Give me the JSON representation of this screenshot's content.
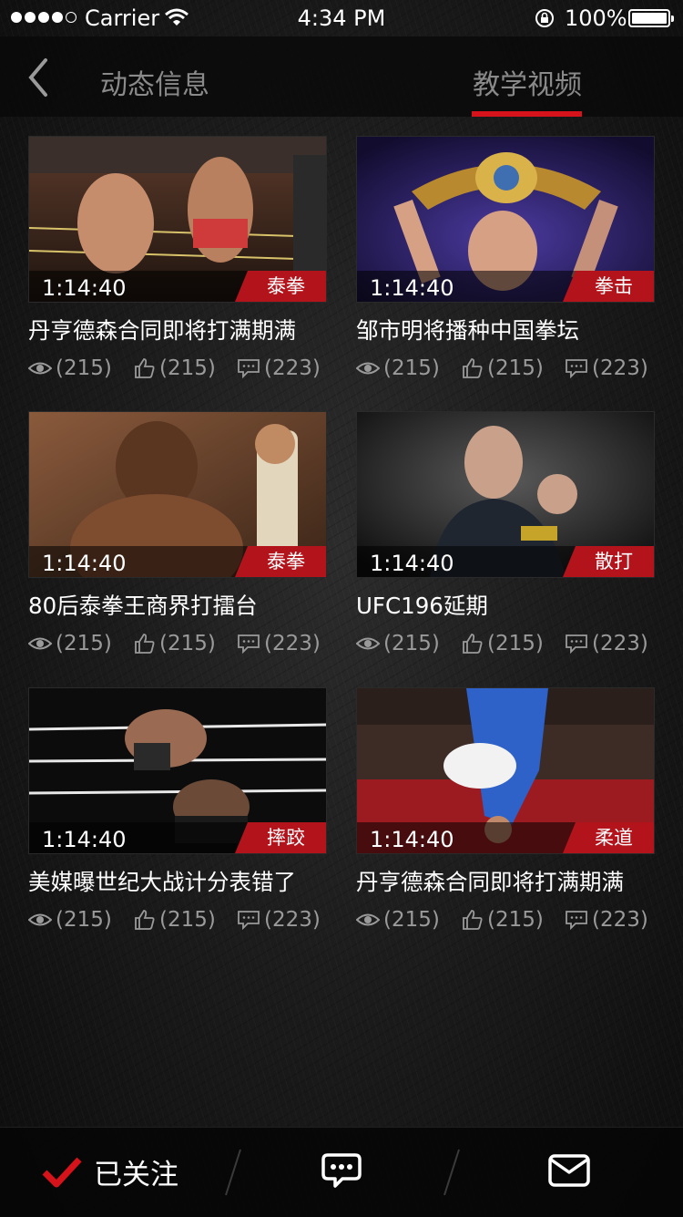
{
  "status_bar": {
    "carrier": "Carrier",
    "time": "4:34 PM",
    "battery": "100%"
  },
  "header": {
    "tabs": [
      {
        "label": "动态信息",
        "active": false
      },
      {
        "label": "教学视频",
        "active": true
      }
    ],
    "accent_color": "#d6121a"
  },
  "videos": [
    {
      "duration": "1:14:40",
      "tag": "泰拳",
      "title": "丹亨德森合同即将打满期满",
      "views": "(215)",
      "likes": "(215)",
      "comments": "(223)"
    },
    {
      "duration": "1:14:40",
      "tag": "拳击",
      "title": "邹市明将播种中国拳坛",
      "views": "(215)",
      "likes": "(215)",
      "comments": "(223)"
    },
    {
      "duration": "1:14:40",
      "tag": "泰拳",
      "title": "80后泰拳王商界打擂台",
      "views": "(215)",
      "likes": "(215)",
      "comments": "(223)"
    },
    {
      "duration": "1:14:40",
      "tag": "散打",
      "title": "UFC196延期",
      "views": "(215)",
      "likes": "(215)",
      "comments": "(223)"
    },
    {
      "duration": "1:14:40",
      "tag": "摔跤",
      "title": "美媒曝世纪大战计分表错了",
      "views": "(215)",
      "likes": "(215)",
      "comments": "(223)"
    },
    {
      "duration": "1:14:40",
      "tag": "柔道",
      "title": "丹亨德森合同即将打满期满",
      "views": "(215)",
      "likes": "(215)",
      "comments": "(223)"
    }
  ],
  "icons": {
    "views": "eye-icon",
    "likes": "thumbs-up-icon",
    "comments": "comment-icon"
  },
  "bottom_bar": {
    "follow_label": "已关注",
    "follow_icon": "checkmark-icon",
    "chat_icon": "chat-bubble-icon",
    "mail_icon": "envelope-icon"
  }
}
